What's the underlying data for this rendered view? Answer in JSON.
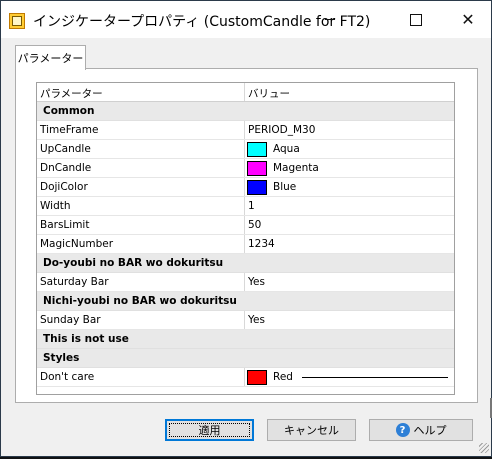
{
  "window": {
    "title": "インジケータープロパティ (CustomCandle for FT2)",
    "controls": {
      "minimize": "minimize-icon",
      "maximize": "maximize-icon",
      "close": "✕"
    }
  },
  "tabs": [
    {
      "label": "パラメーター",
      "selected": true
    }
  ],
  "grid": {
    "headers": {
      "name": "パラメーター",
      "value": "バリュー"
    },
    "rows": [
      {
        "type": "section",
        "name": "Common"
      },
      {
        "type": "param",
        "name": "TimeFrame",
        "value": "PERIOD_M30"
      },
      {
        "type": "color",
        "name": "UpCandle",
        "value": "Aqua",
        "color": "#00ffff"
      },
      {
        "type": "color",
        "name": "DnCandle",
        "value": "Magenta",
        "color": "#ff00ff"
      },
      {
        "type": "color",
        "name": "DojiColor",
        "value": "Blue",
        "color": "#0000ff"
      },
      {
        "type": "param",
        "name": "Width",
        "value": "1"
      },
      {
        "type": "param",
        "name": "BarsLimit",
        "value": "50"
      },
      {
        "type": "param",
        "name": "MagicNumber",
        "value": "1234"
      },
      {
        "type": "section",
        "name": "Do-youbi no BAR wo dokuritsu"
      },
      {
        "type": "param",
        "name": "Saturday Bar",
        "value": "Yes"
      },
      {
        "type": "section",
        "name": "Nichi-youbi no BAR wo dokuritsu"
      },
      {
        "type": "param",
        "name": "Sunday Bar",
        "value": "Yes"
      },
      {
        "type": "section",
        "name": "This is not use"
      },
      {
        "type": "section",
        "name": "Styles"
      },
      {
        "type": "color-line",
        "name": "Don't care",
        "value": "Red",
        "color": "#ff0000"
      }
    ]
  },
  "buttons": {
    "ok": "適用",
    "cancel": "キャンセル",
    "help": "ヘルプ",
    "help_icon": "?"
  }
}
